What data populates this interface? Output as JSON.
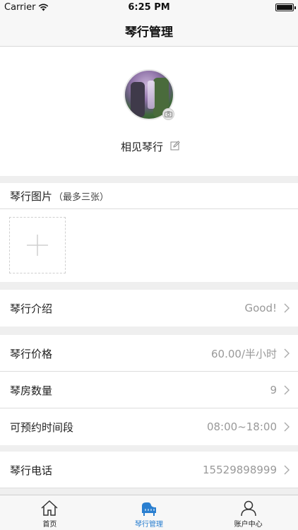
{
  "status_bar": {
    "carrier": "Carrier",
    "time": "6:25 PM"
  },
  "nav": {
    "title": "琴行管理"
  },
  "profile": {
    "name": "相见琴行"
  },
  "images": {
    "title": "琴行图片",
    "note": "（最多三张）"
  },
  "rows": [
    {
      "label": "琴行介绍",
      "value": "Good!"
    },
    {
      "label": "琴行价格",
      "value": "60.00/半小时"
    },
    {
      "label": "琴房数量",
      "value": "9"
    },
    {
      "label": "可预约时间段",
      "value": "08:00~18:00"
    },
    {
      "label": "琴行电话",
      "value": "15529898999"
    }
  ],
  "tabs": [
    {
      "label": "首页",
      "icon": "home-icon"
    },
    {
      "label": "琴行管理",
      "icon": "piano-icon",
      "active": true
    },
    {
      "label": "账户中心",
      "icon": "person-icon"
    }
  ],
  "colors": {
    "accent": "#2a7fd0",
    "secondary_text": "#999999",
    "background": "#efefef"
  }
}
